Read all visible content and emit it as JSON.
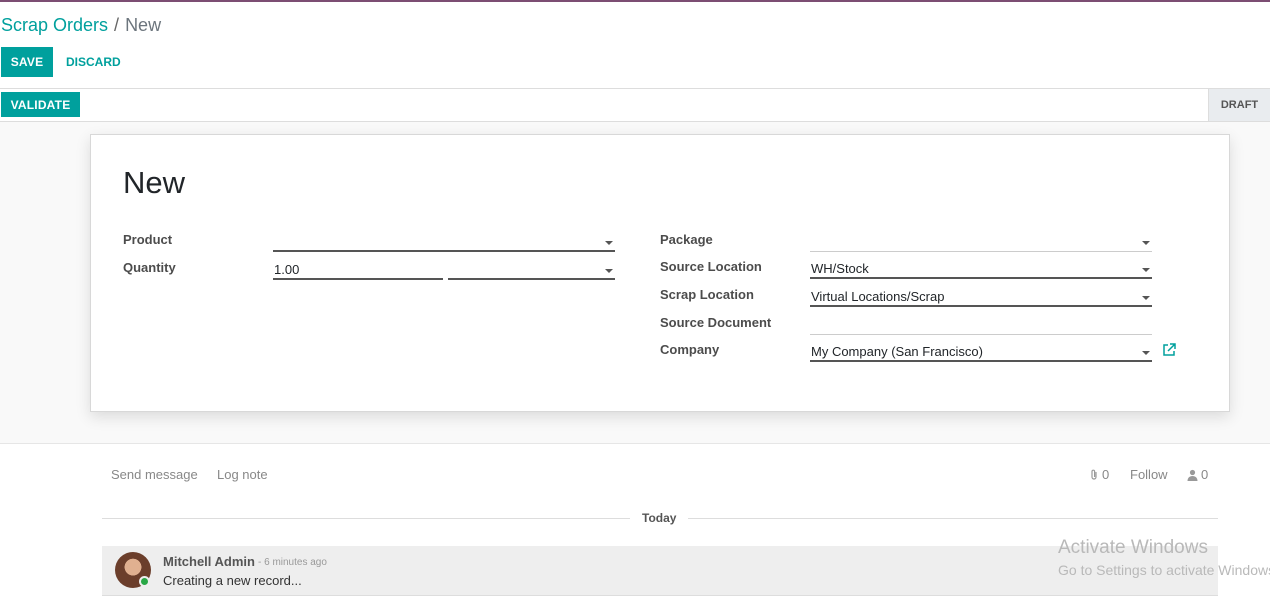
{
  "breadcrumb": {
    "parent": "Scrap Orders",
    "separator": "/",
    "current": "New"
  },
  "toolbar": {
    "save_label": "SAVE",
    "discard_label": "DISCARD"
  },
  "statusbar": {
    "validate_label": "VALIDATE",
    "status": "DRAFT"
  },
  "form": {
    "title": "New",
    "labels": {
      "product": "Product",
      "quantity": "Quantity",
      "package": "Package",
      "source_location": "Source Location",
      "scrap_location": "Scrap Location",
      "source_document": "Source Document",
      "company": "Company"
    },
    "values": {
      "product": "",
      "quantity": "1.00",
      "uom": "",
      "package": "",
      "source_location": "WH/Stock",
      "scrap_location": "Virtual Locations/Scrap",
      "source_document": "",
      "company": "My Company (San Francisco)"
    }
  },
  "chatter": {
    "send_message": "Send message",
    "log_note": "Log note",
    "attachments_count": "0",
    "follow": "Follow",
    "followers_count": "0",
    "date_separator": "Today",
    "messages": [
      {
        "author": "Mitchell Admin",
        "date": "- 6 minutes ago",
        "body": "Creating a new record..."
      }
    ]
  },
  "watermark": {
    "line1": "Activate Windows",
    "line2": "Go to Settings to activate Windows."
  },
  "colors": {
    "accent": "#00a09d",
    "brand_bar": "#7c4d73",
    "online": "#28a745"
  }
}
